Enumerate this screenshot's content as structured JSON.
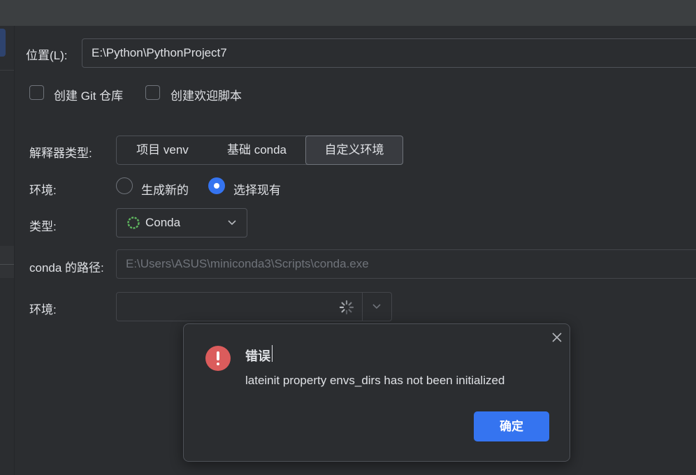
{
  "location": {
    "label": "位置(L):",
    "value": "E:\\Python\\PythonProject7"
  },
  "checkboxes": [
    {
      "label": "创建 Git 仓库",
      "checked": false
    },
    {
      "label": "创建欢迎脚本",
      "checked": false
    }
  ],
  "interpreter": {
    "label": "解释器类型:",
    "options": [
      "项目 venv",
      "基础 conda",
      "自定义环境"
    ],
    "selected": "自定义环境"
  },
  "environment_mode": {
    "label": "环境:",
    "options": [
      {
        "label": "生成新的",
        "selected": false
      },
      {
        "label": "选择现有",
        "selected": true
      }
    ]
  },
  "type": {
    "label": "类型:",
    "value": "Conda",
    "icon": "conda-spinner-icon"
  },
  "conda_path": {
    "label": "conda 的路径:",
    "value": "E:\\Users\\ASUS\\miniconda3\\Scripts\\conda.exe"
  },
  "environment": {
    "label": "环境:",
    "value": "",
    "icon": "loading-spinner-icon"
  },
  "dialog": {
    "title": "错误",
    "message": "lateinit property envs_dirs has not been initialized",
    "ok_label": "确定",
    "icon": "error-icon"
  },
  "colors": {
    "accent": "#3574f0",
    "error": "#db5c5c",
    "background": "#2b2d30",
    "conda_green": "#5fb85f"
  }
}
